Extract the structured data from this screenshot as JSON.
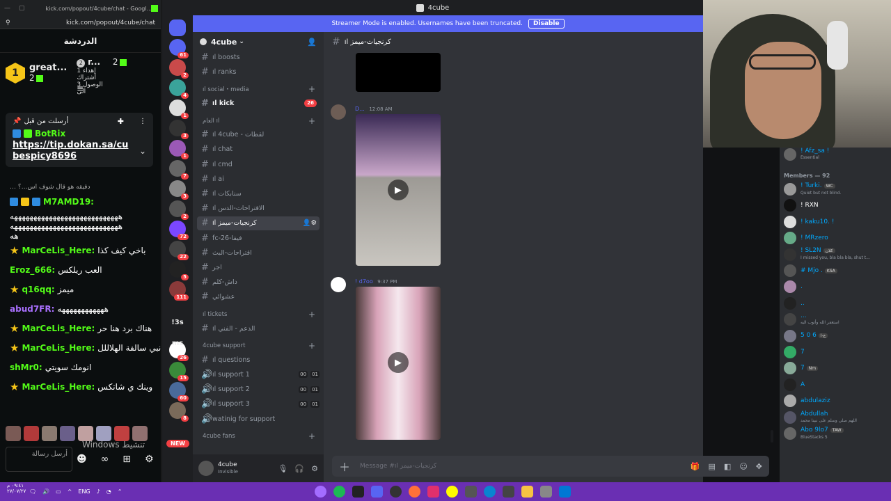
{
  "kick": {
    "window_url_short": "kick.com/popout/4cube/chat - Googl...",
    "address": "kick.com/popout/4cube/chat",
    "header": "الدردشة",
    "leaderboard": [
      {
        "rank": "1",
        "name": "great...",
        "count": "2"
      },
      {
        "rank": "2",
        "name": "r...",
        "count": "2",
        "sub": "إهداء 1 أشتراك الوصول 3 الى"
      }
    ],
    "pinned": {
      "label": "أرسلت من قبل",
      "user": "BotRix",
      "link": "https://tip.dokan.sa/cubespicy8696"
    },
    "messages": [
      {
        "user": "",
        "text": "… دقيقه هو قال شوف اس…؟",
        "color": "#aaaaaa",
        "small": true
      },
      {
        "user": "M7AMD19:",
        "text": "",
        "color": "#53fc18"
      },
      {
        "user": "",
        "text": "ههههههههههههههههههههههههههههه",
        "color": "#ffffff"
      },
      {
        "user": "",
        "text": "ههههههههههههههههههههههههههههه",
        "color": "#ffffff"
      },
      {
        "user": "",
        "text": "هه",
        "color": "#ffffff"
      },
      {
        "user": "MarCeLis_Here:",
        "text": "باخي كيف كذا",
        "color": "#53fc18",
        "star": true
      },
      {
        "user": "Eroz_666:",
        "text": "العب ريلكس",
        "color": "#53fc18"
      },
      {
        "user": "q16qq:",
        "text": "ميمز",
        "color": "#53fc18",
        "star": true
      },
      {
        "user": "abud7FR:",
        "text": "ههههههههههههه",
        "color": "#a970ff"
      },
      {
        "user": "MarCeLis_Here:",
        "text": "هناك برد هنا حر",
        "color": "#53fc18",
        "star": true
      },
      {
        "user": "MarCeLis_Here:",
        "text": "نبي سالفة الهلاللل",
        "color": "#53fc18",
        "star": true
      },
      {
        "user": "shMr0:",
        "text": "انومك سويتي",
        "color": "#53fc18"
      },
      {
        "user": "MarCeLis_Here:",
        "text": "وينك ي شاتكس",
        "color": "#53fc18",
        "star": true
      }
    ],
    "input_placeholder": "أرسل رسالة",
    "activate_windows": "Windows تنشيط"
  },
  "discord": {
    "window_title": "4cube",
    "streamer_banner": "Streamer Mode is enabled. Usernames have been truncated.",
    "disable_label": "Disable",
    "server_name": "4cube",
    "channels": [
      {
        "name": "ıl boosts",
        "type": "text",
        "top": 0
      },
      {
        "name": "ıl ranks",
        "type": "text"
      },
      {
        "cat": "ıl social・media"
      },
      {
        "name": "ıl kick",
        "type": "text",
        "bold": true,
        "mention": "26"
      },
      {
        "cat": "العام ıl"
      },
      {
        "name": "ıl 4cube - لقطات",
        "type": "text"
      },
      {
        "name": "ıl chat",
        "type": "text"
      },
      {
        "name": "ıl cmd",
        "type": "text"
      },
      {
        "name": "ıl ai",
        "type": "text"
      },
      {
        "name": "ıl سنابكات",
        "type": "text"
      },
      {
        "name": "ıl الاقتراحات-الدس",
        "type": "text"
      },
      {
        "name": "ıl كرنجيات-ميمز",
        "type": "text",
        "active": true
      },
      {
        "name": "fc-26-فيفا",
        "type": "text"
      },
      {
        "name": "اقتراحات-البث",
        "type": "text"
      },
      {
        "name": "اجر",
        "type": "text"
      },
      {
        "name": "داش-كلم",
        "type": "text"
      },
      {
        "name": "عشوائي",
        "type": "text"
      },
      {
        "cat": "ıl tickets"
      },
      {
        "name": "ıl الدعم - الفني",
        "type": "text"
      },
      {
        "cat": "4cube support"
      },
      {
        "name": "ıl questions",
        "type": "text"
      },
      {
        "name": "ıl support 1",
        "type": "voice",
        "vc": [
          "00",
          "01"
        ]
      },
      {
        "name": "ıl support 2",
        "type": "voice",
        "vc": [
          "00",
          "01"
        ]
      },
      {
        "name": "ıl support 3",
        "type": "voice",
        "vc": [
          "00",
          "01"
        ]
      },
      {
        "name": "watinig for support",
        "type": "voice"
      },
      {
        "cat": "4cube fans"
      }
    ],
    "guild_badges": [
      "61",
      "2",
      "4",
      "1",
      "3",
      "1",
      "7",
      "3",
      "2",
      "72",
      "22",
      "5",
      "111",
      "26",
      "15",
      "60",
      "8"
    ],
    "guild_texts": [
      "!3s",
      "ms"
    ],
    "new_label": "NEW",
    "user": {
      "name": "4cube",
      "status": "Invisible"
    },
    "chat": {
      "channel": "ıl كرنجيات-ميمز",
      "messages": [
        {
          "author": "D...",
          "time": "12:08 AM"
        },
        {
          "author": "! d7oo",
          "time": "9:37 PM"
        }
      ],
      "composer_placeholder": "Message #ıl كرنجيات-ميمز"
    }
  },
  "members": {
    "header": "Members — 92",
    "top": {
      "name": "! Afz_sa !",
      "sub": "Essential"
    },
    "list": [
      {
        "name": "! Turki.",
        "tag": "WC",
        "sub": "Quiet but not blind."
      },
      {
        "name": "! RXN"
      },
      {
        "name": "! kaku10. !"
      },
      {
        "name": "! MRzero"
      },
      {
        "name": "! SL2N",
        "tag": "كلان",
        "sub": "I missed you, bla bla bla, shut t..."
      },
      {
        "name": "# Mjo .",
        "tag": "KSA"
      },
      {
        "name": "."
      },
      {
        "name": ".."
      },
      {
        "name": "...",
        "sub": "استغفر الله وأتوب اليه"
      },
      {
        "name": "5 0 6",
        "tag": "ع-ا"
      },
      {
        "name": "7"
      },
      {
        "name": "7",
        "tag": "Nm"
      },
      {
        "name": "A"
      },
      {
        "name": "abdulaziz"
      },
      {
        "name": "Abdullah",
        "sub": "اللهم صلي وسلم على نبينا محمد"
      },
      {
        "name": "Abo 9lo7",
        "tag": "TAW",
        "sub": "BlueStacks 5"
      }
    ]
  },
  "taskbar": {
    "clock_time": "٠٩:٤١ م",
    "clock_date": "٢٧/٠٧/٢٧",
    "lang": "ENG"
  },
  "colors": {
    "accent": "#5865f2",
    "kick_green": "#53fc18",
    "taskbar": "#6a2fb3"
  }
}
